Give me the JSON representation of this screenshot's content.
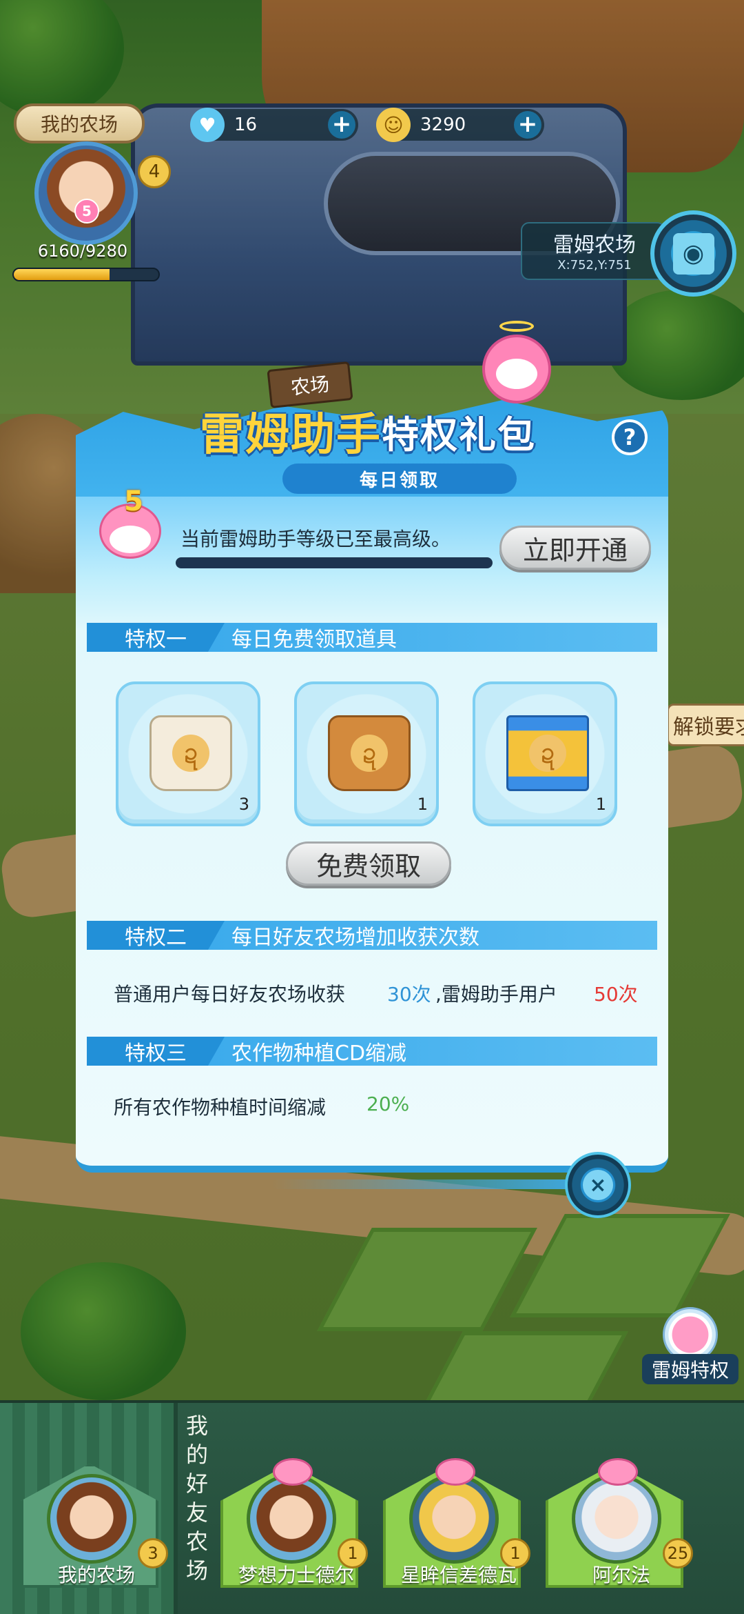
{
  "hud": {
    "farm_label": "我的农场",
    "level": "4",
    "pet_level": "5",
    "exp_text": "6160/9280",
    "exp_fraction": 0.664,
    "gems": "16",
    "coins": "3290",
    "plus": "+"
  },
  "location": {
    "name": "雷姆农场",
    "coords": "X:752,Y:751"
  },
  "unlock_tag": "解锁要求",
  "popup": {
    "sign": "农场",
    "title_part1": "雷姆助手",
    "title_part2": "特权礼包",
    "help": "?",
    "subtitle": "每日领取",
    "pet_level": "5",
    "level_text": "当前雷姆助手等级已至最高级。",
    "open_button": "立即开通",
    "privileges": [
      {
        "num": "特权一",
        "name": "每日免费领取道具"
      },
      {
        "num": "特权二",
        "name": "每日好友农场增加收获次数"
      },
      {
        "num": "特权三",
        "name": "农作物种植CD缩减"
      }
    ],
    "items": [
      {
        "count": "3",
        "glyph": "ဍ"
      },
      {
        "count": "1",
        "glyph": "ဍ"
      },
      {
        "count": "1",
        "glyph": "ဍ"
      }
    ],
    "claim_button": "免费领取",
    "priv2_text1": "普通用户每日好友农场收获",
    "priv2_val1": "30次",
    "priv2_text2": ",雷姆助手用户",
    "priv2_val2": "50次",
    "priv3_text": "所有农作物种植时间缩减",
    "priv3_val": "20%",
    "close": "×"
  },
  "side_privilege": {
    "label": "雷姆特权"
  },
  "bottom": {
    "my_farm": {
      "name": "我的农场",
      "level": "3"
    },
    "friends_label": "我的好友农场",
    "friends": [
      {
        "name": "梦想力士德尔",
        "level": "1"
      },
      {
        "name": "星眸信差德瓦",
        "level": "1"
      },
      {
        "name": "阿尔法",
        "level": "25"
      }
    ]
  }
}
